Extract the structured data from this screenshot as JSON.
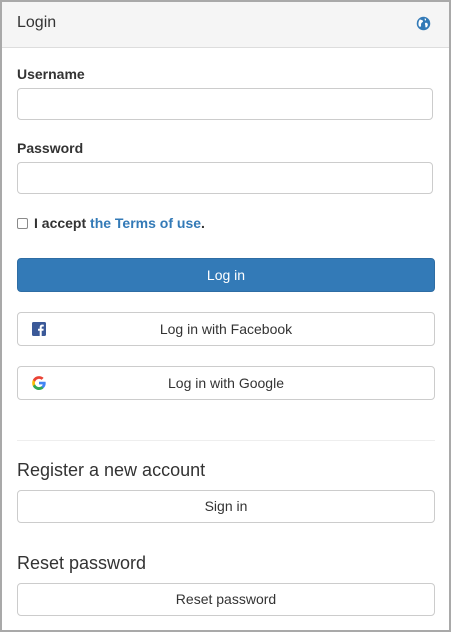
{
  "panel": {
    "title": "Login",
    "language_icon": "globe-icon"
  },
  "form": {
    "username_label": "Username",
    "username_value": "",
    "password_label": "Password",
    "password_value": "",
    "terms_checked": false,
    "terms_prefix": "I accept ",
    "terms_link": "the Terms of use",
    "terms_suffix": ".",
    "login_button": "Log in"
  },
  "social": {
    "facebook_label": "Log in with Facebook",
    "facebook_icon": "facebook-icon",
    "google_label": "Log in with Google",
    "google_icon": "google-icon"
  },
  "register": {
    "title": "Register a new account",
    "button": "Sign in"
  },
  "reset": {
    "title": "Reset password",
    "button": "Reset password"
  },
  "colors": {
    "primary": "#337ab7",
    "header_bg": "#f5f5f5",
    "facebook": "#3b5998"
  }
}
